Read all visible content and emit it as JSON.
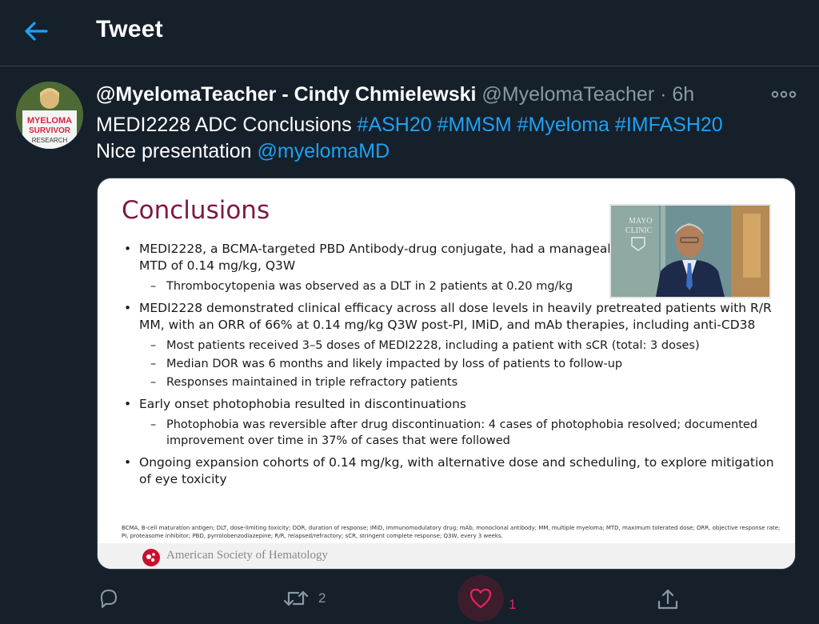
{
  "header": {
    "title": "Tweet"
  },
  "tweet": {
    "display_name": "@MyelomaTeacher - Cindy Chmielewski",
    "handle": "@MyelomaTeacher",
    "separator": "·",
    "time": "6h",
    "text_line1": "MEDI2228 ADC  Conclusions ",
    "hashtags": [
      "#ASH20",
      "#MMSM",
      "#Myeloma",
      "#IMFASH20"
    ],
    "text_line2": "Nice presentation ",
    "mention": "@myelomaMD",
    "avatar_text": [
      "MYELOMA",
      "SURVIVOR",
      "RESEARCH"
    ]
  },
  "slide": {
    "title": "Conclusions",
    "bullets": [
      {
        "text": "MEDI2228, a BCMA-targeted PBD Antibody-drug conjugate, had a manageable safety profile with an MTD of 0.14 mg/kg, Q3W",
        "subs": [
          "Thrombocytopenia was observed as a DLT in 2 patients at 0.20 mg/kg"
        ]
      },
      {
        "text": "MEDI2228 demonstrated clinical efficacy across all dose levels in heavily pretreated patients with R/R MM, with an ORR of 66% at 0.14 mg/kg Q3W post-PI, IMiD, and mAb therapies, including anti-CD38",
        "subs": [
          "Most patients received 3–5 doses of MEDI2228, including a patient with sCR (total: 3 doses)",
          "Median DOR was 6 months and likely impacted by loss of patients to follow-up",
          "Responses maintained in triple refractory patients"
        ]
      },
      {
        "text": "Early onset photophobia resulted in discontinuations",
        "subs": [
          "Photophobia was reversible after drug discontinuation: 4 cases of photophobia resolved; documented improvement over time in 37% of cases that were followed"
        ]
      },
      {
        "text": "Ongoing expansion cohorts of 0.14 mg/kg, with alternative dose and scheduling, to explore mitigation of eye toxicity",
        "subs": []
      }
    ],
    "footnote": "BCMA, B-cell maturation antigen; DLT, dose-limiting toxicity; DOR, duration of response; IMiD, immunomodulatory drug; mAb, monoclonal antibody; MM, multiple myeloma; MTD, maximum tolerated dose; ORR, objective response rate; PI, proteasome inhibitor; PBD, pyrrolobenzodiazepine; R/R, relapsed/refractory; sCR, stringent complete response; Q3W, every 3 weeks.",
    "society": "American Society of Hematology",
    "video_logo": [
      "MAYO",
      "CLINIC"
    ]
  },
  "actions": {
    "reply": {
      "icon": "reply-icon",
      "count": ""
    },
    "retweet": {
      "icon": "retweet-icon",
      "count": "2"
    },
    "like": {
      "icon": "heart-icon",
      "count": "1"
    },
    "share": {
      "icon": "share-icon"
    }
  },
  "colors": {
    "background": "#15202b",
    "accent": "#1da1f2",
    "like": "#e0245e",
    "muted": "#8899a6",
    "slide_title": "#7d1846"
  }
}
